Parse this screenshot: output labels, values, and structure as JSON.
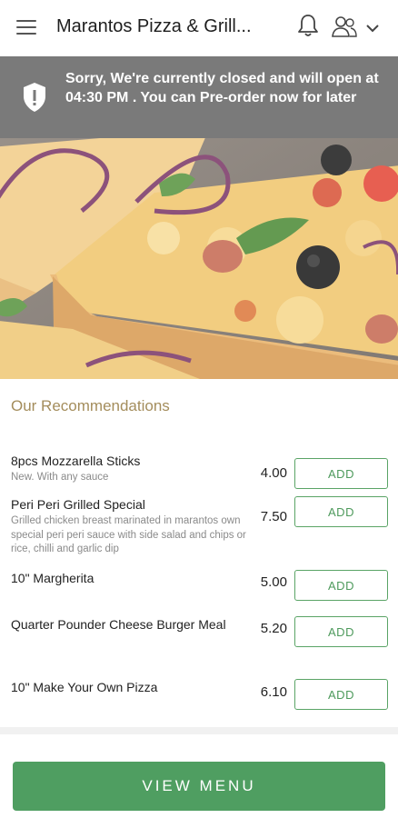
{
  "header": {
    "title": "Marantos Pizza & Grill..."
  },
  "banner": {
    "message": "Sorry, We're currently closed and will open at 04:30 PM . You can Pre-order now for later"
  },
  "recommendations": {
    "title": "Our Recommendations",
    "add_label": "ADD",
    "items": [
      {
        "name": "8pcs Mozzarella Sticks",
        "desc": "New. With any sauce",
        "price": "4.00"
      },
      {
        "name": "Peri Peri Grilled Special",
        "desc": "Grilled chicken breast marinated in marantos own special peri peri sauce with side salad and chips or rice, chilli and garlic dip",
        "price": "7.50"
      },
      {
        "name": "10\" Margherita",
        "desc": "",
        "price": "5.00"
      },
      {
        "name": "Quarter Pounder Cheese Burger Meal",
        "desc": "",
        "price": "5.20"
      },
      {
        "name": "10\" Make Your Own Pizza",
        "desc": "",
        "price": "6.10"
      }
    ]
  },
  "footer": {
    "view_menu_label": "VIEW MENU"
  },
  "colors": {
    "accent_green": "#4f9e61",
    "banner_gray": "#7a7a7a",
    "section_title": "#a48d5c"
  },
  "icons": {
    "menu": "hamburger-icon",
    "bell": "bell-icon",
    "user": "user-icon",
    "chevron": "chevron-down-icon",
    "shield": "shield-alert-icon"
  }
}
